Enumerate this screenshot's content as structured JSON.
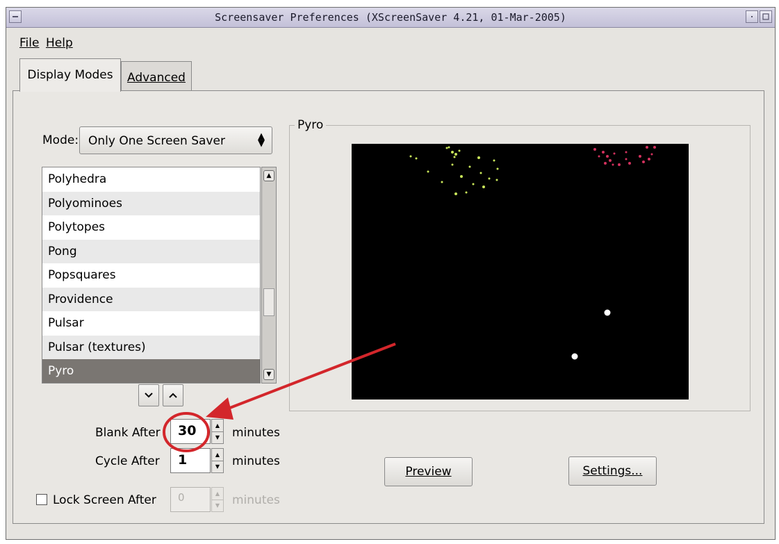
{
  "window": {
    "title": "Screensaver Preferences  (XScreenSaver 4.21, 01-Mar-2005)"
  },
  "menu": {
    "file": "File",
    "help": "Help"
  },
  "tabs": [
    {
      "label": "Display Modes",
      "active": true
    },
    {
      "label": "Advanced",
      "active": false
    }
  ],
  "mode": {
    "label": "Mode:",
    "selected": "Only One Screen Saver"
  },
  "screensaver_list": {
    "items": [
      "Polyhedra",
      "Polyominoes",
      "Polytopes",
      "Pong",
      "Popsquares",
      "Providence",
      "Pulsar",
      "Pulsar (textures)",
      "Pyro"
    ],
    "selected": "Pyro"
  },
  "timing": {
    "blank_after_label": "Blank After",
    "blank_after_value": "30",
    "cycle_after_label": "Cycle After",
    "cycle_after_value": "1",
    "lock_screen_label": "Lock Screen After",
    "lock_screen_value": "0",
    "lock_screen_checked": false,
    "units": "minutes"
  },
  "preview": {
    "frame_title": "Pyro",
    "preview_button": "Preview",
    "settings_button": "Settings..."
  },
  "annotation": {
    "color": "#d3262b"
  }
}
